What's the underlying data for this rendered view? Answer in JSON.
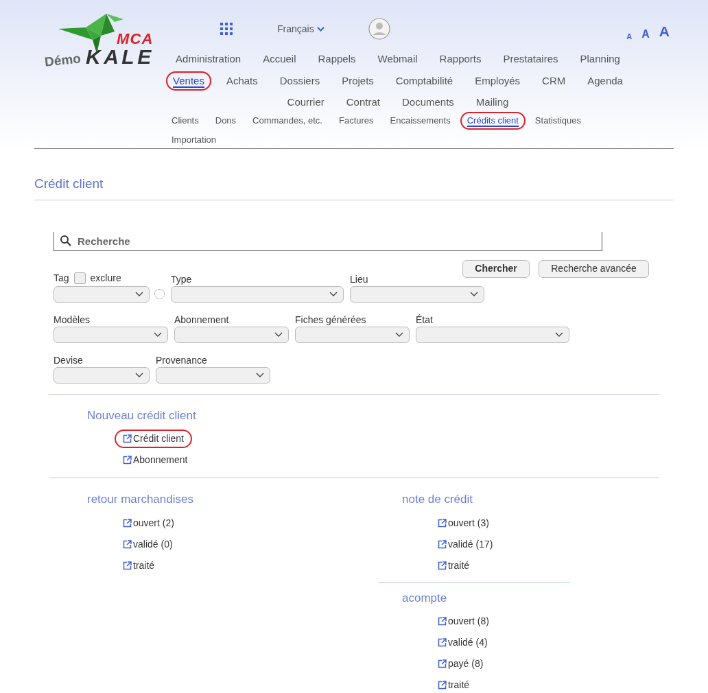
{
  "header": {
    "logo": {
      "demo": "Démo",
      "brand": "KALE",
      "badge": "MCA"
    },
    "language": "Français",
    "font_sizes": [
      "A",
      "A",
      "A"
    ]
  },
  "main_menu": [
    {
      "label": "Administration",
      "selected": false,
      "highlighted": false
    },
    {
      "label": "Accueil",
      "selected": false,
      "highlighted": false
    },
    {
      "label": "Rappels",
      "selected": false,
      "highlighted": false
    },
    {
      "label": "Webmail",
      "selected": false,
      "highlighted": false
    },
    {
      "label": "Rapports",
      "selected": false,
      "highlighted": false
    },
    {
      "label": "Prestataires",
      "selected": false,
      "highlighted": false
    },
    {
      "label": "Planning",
      "selected": false,
      "highlighted": false
    },
    {
      "label": "Ventes",
      "selected": true,
      "highlighted": true
    },
    {
      "label": "Achats",
      "selected": false,
      "highlighted": false
    },
    {
      "label": "Dossiers",
      "selected": false,
      "highlighted": false
    },
    {
      "label": "Projets",
      "selected": false,
      "highlighted": false
    },
    {
      "label": "Comptabilité",
      "selected": false,
      "highlighted": false
    },
    {
      "label": "Employés",
      "selected": false,
      "highlighted": false
    },
    {
      "label": "CRM",
      "selected": false,
      "highlighted": false
    },
    {
      "label": "Agenda",
      "selected": false,
      "highlighted": false
    },
    {
      "label": "Courrier",
      "selected": false,
      "highlighted": false
    },
    {
      "label": "Contrat",
      "selected": false,
      "highlighted": false
    },
    {
      "label": "Documents",
      "selected": false,
      "highlighted": false
    },
    {
      "label": "Mailing",
      "selected": false,
      "highlighted": false
    }
  ],
  "sub_menu": [
    {
      "label": "Clients",
      "selected": false,
      "highlighted": false
    },
    {
      "label": "Dons",
      "selected": false,
      "highlighted": false
    },
    {
      "label": "Commandes, etc.",
      "selected": false,
      "highlighted": false
    },
    {
      "label": "Factures",
      "selected": false,
      "highlighted": false
    },
    {
      "label": "Encaissements",
      "selected": false,
      "highlighted": false
    },
    {
      "label": "Crédits client",
      "selected": true,
      "highlighted": true
    },
    {
      "label": "Statistiques",
      "selected": false,
      "highlighted": false
    },
    {
      "label": "Importation",
      "selected": false,
      "highlighted": false
    }
  ],
  "page_title": "Crédit client",
  "search": {
    "placeholder": "Recherche",
    "buttons": [
      "Chercher",
      "Recherche avancée"
    ]
  },
  "filters": [
    [
      {
        "kind": "tag",
        "label": "Tag",
        "exclude_label": "exclure",
        "exclude_checked": false
      },
      {
        "kind": "select",
        "label": "Type"
      },
      {
        "kind": "select",
        "label": "Lieu"
      }
    ],
    [
      {
        "kind": "select",
        "label": "Modèles"
      },
      {
        "kind": "select",
        "label": "Abonnement"
      },
      {
        "kind": "select",
        "label": "Fiches générées"
      },
      {
        "kind": "select",
        "label": "État"
      }
    ],
    [
      {
        "kind": "select",
        "label": "Devise"
      },
      {
        "kind": "select",
        "label": "Provenance"
      }
    ]
  ],
  "new_section": {
    "title": "Nouveau crédit client",
    "links": [
      {
        "label": "Crédit client",
        "highlighted": true
      },
      {
        "label": "Abonnement",
        "highlighted": false
      }
    ]
  },
  "groups": [
    {
      "title": "retour marchandises",
      "links": [
        {
          "label": "ouvert (2)",
          "highlighted": false
        },
        {
          "label": "validé (0)",
          "highlighted": false
        },
        {
          "label": "traité",
          "highlighted": false
        }
      ]
    },
    {
      "title": "note de crédit",
      "links": [
        {
          "label": "ouvert (3)",
          "highlighted": false
        },
        {
          "label": "validé (17)",
          "highlighted": false
        },
        {
          "label": "traité",
          "highlighted": false
        }
      ]
    },
    {
      "title": "acompte",
      "links": [
        {
          "label": "ouvert (8)",
          "highlighted": false
        },
        {
          "label": "validé (4)",
          "highlighted": false
        },
        {
          "label": "payé (8)",
          "highlighted": false
        },
        {
          "label": "traité",
          "highlighted": false
        }
      ]
    }
  ]
}
